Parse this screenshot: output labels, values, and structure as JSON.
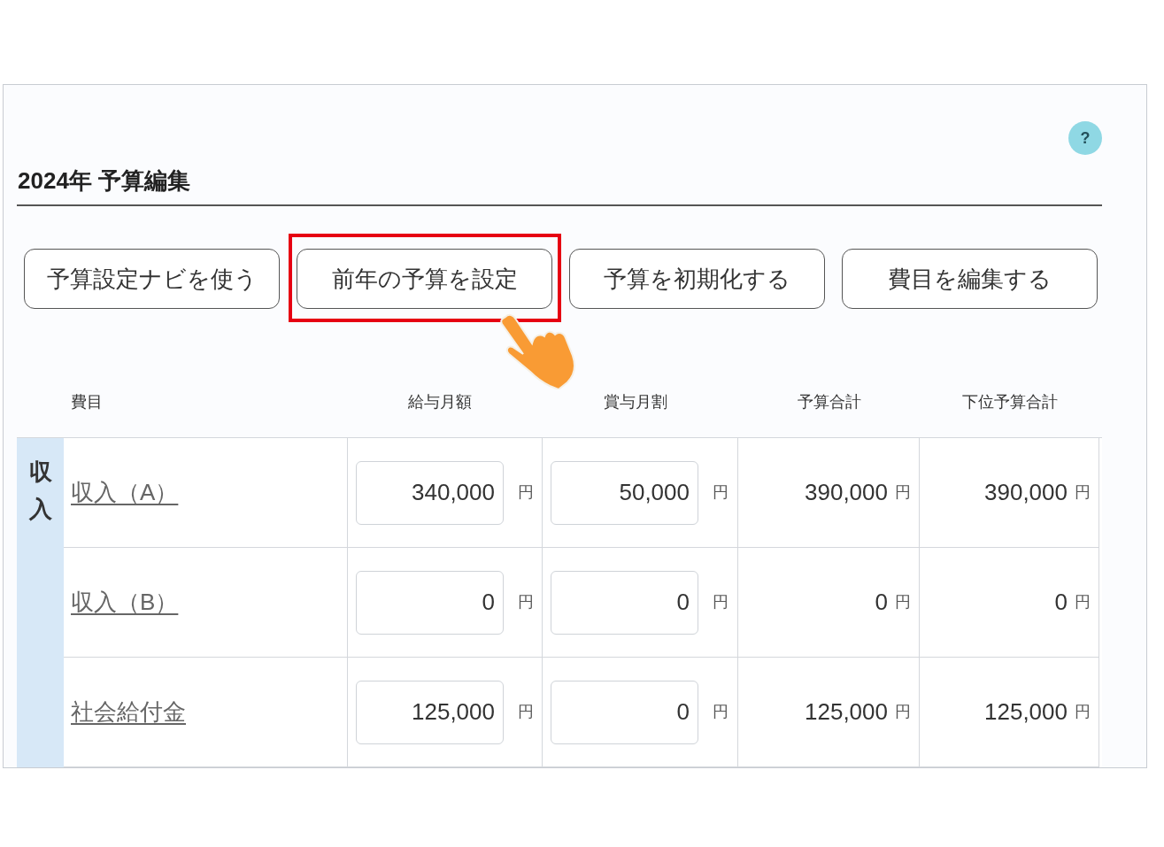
{
  "help": {
    "label": "?"
  },
  "title": "2024年 予算編集",
  "buttons": [
    {
      "label": "予算設定ナビを使う",
      "highlighted": false
    },
    {
      "label": "前年の予算を設定",
      "highlighted": true
    },
    {
      "label": "予算を初期化する",
      "highlighted": false
    },
    {
      "label": "費目を編集する",
      "highlighted": false
    }
  ],
  "columns": [
    "費目",
    "給与月額",
    "賞与月割",
    "予算合計",
    "下位予算合計"
  ],
  "group": {
    "label": "収入"
  },
  "rows": [
    {
      "name": "収入（A）",
      "salary": "340,000",
      "salary_unit": "円",
      "bonus": "50,000",
      "bonus_unit": "円",
      "total": "390,000",
      "total_unit": "円",
      "sub_total": "390,000",
      "sub_total_unit": "円"
    },
    {
      "name": "収入（B）",
      "salary": "0",
      "salary_unit": "円",
      "bonus": "0",
      "bonus_unit": "円",
      "total": "0",
      "total_unit": "円",
      "sub_total": "0",
      "sub_total_unit": "円"
    },
    {
      "name": "社会給付金",
      "salary": "125,000",
      "salary_unit": "円",
      "bonus": "0",
      "bonus_unit": "円",
      "total": "125,000",
      "total_unit": "円",
      "sub_total": "125,000",
      "sub_total_unit": "円"
    }
  ]
}
